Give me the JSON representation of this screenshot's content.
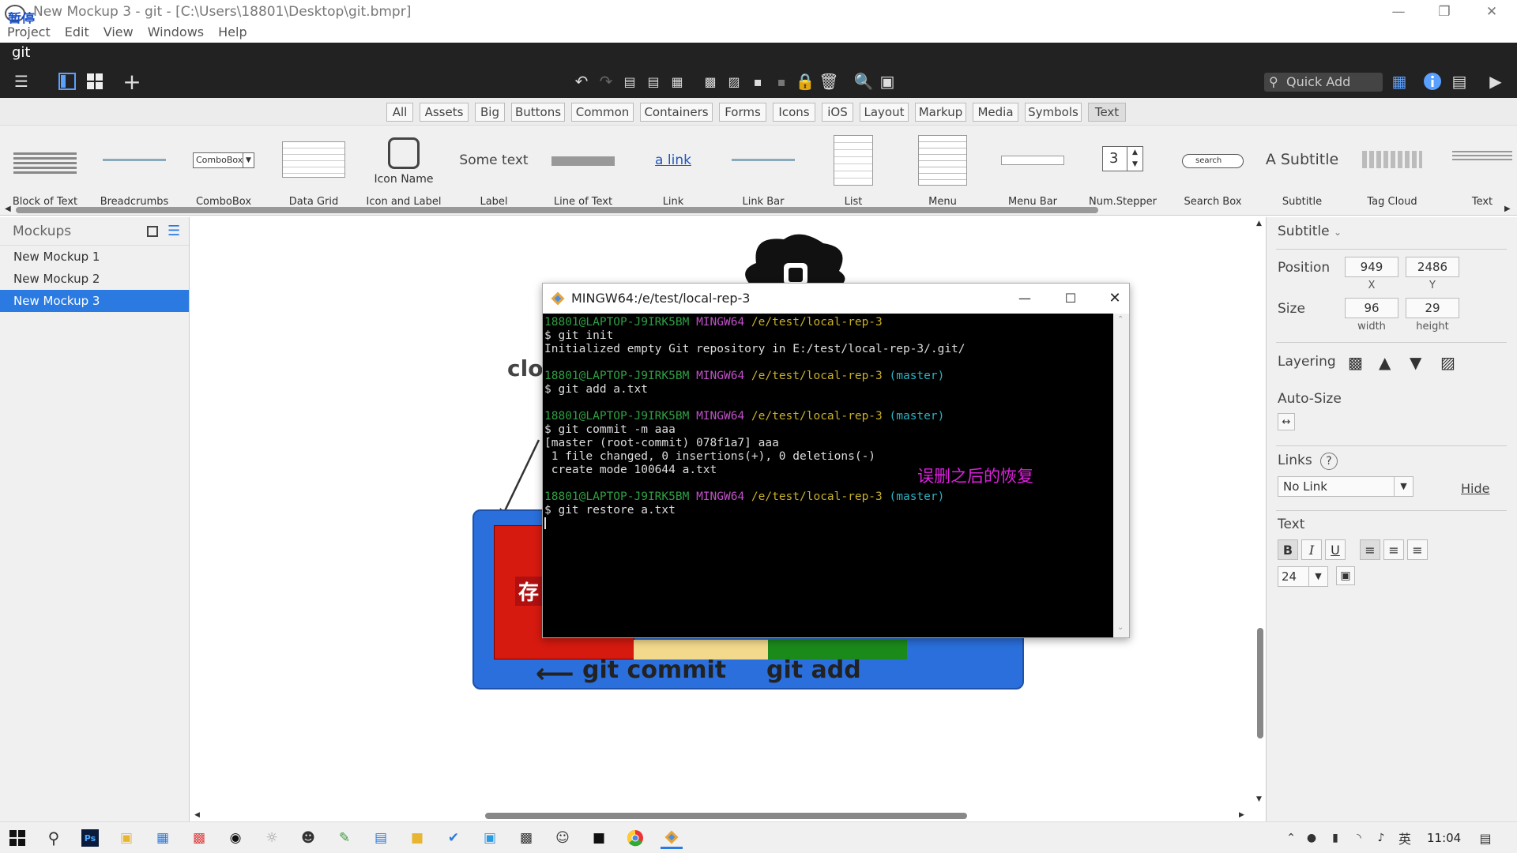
{
  "window": {
    "title": "New Mockup 3 - git - [C:\\Users\\18801\\Desktop\\git.bmpr]",
    "app_overlay_text": "暂停"
  },
  "menu": [
    "Project",
    "Edit",
    "View",
    "Windows",
    "Help"
  ],
  "document_tab": "git",
  "quick_add": {
    "placeholder": "Quick Add"
  },
  "filters": [
    "All",
    "Assets",
    "Big",
    "Buttons",
    "Common",
    "Containers",
    "Forms",
    "Icons",
    "iOS",
    "Layout",
    "Markup",
    "Media",
    "Symbols",
    "Text"
  ],
  "active_filter": "Text",
  "library": {
    "items": [
      "Block of Text",
      "Breadcrumbs",
      "ComboBox",
      "Data Grid",
      "Icon and Label",
      "Label",
      "Line of Text",
      "Link",
      "Link Bar",
      "List",
      "Menu",
      "Menu Bar",
      "Num.Stepper",
      "Search Box",
      "Subtitle",
      "Tag Cloud",
      "Text"
    ],
    "combobox_text": "ComboBox",
    "icon_name_text": "Icon Name",
    "label_text": "Some text",
    "link_text": "a link",
    "stepper_value": "3",
    "search_text": "search",
    "subtitle_text": "A Subtitle"
  },
  "mockups": {
    "header": "Mockups",
    "items": [
      "New Mockup 1",
      "New Mockup 2",
      "New Mockup 3"
    ],
    "selected": "New Mockup 3"
  },
  "canvas": {
    "partial_text": "clo",
    "box_text": "存",
    "git_commit": "git commit",
    "git_add": "git add",
    "colors": {
      "blue": "#2a6fdb",
      "red": "#d71a0f",
      "yellow": "#f3d98b",
      "green": "#1a8a1a"
    }
  },
  "terminal": {
    "title": "MINGW64:/e/test/local-rep-3",
    "user": "18801@LAPTOP-J9IRK5BM",
    "env": "MINGW64",
    "path": "/e/test/local-rep-3",
    "branch": "(master)",
    "cmd1": "$ git init",
    "out1": "Initialized empty Git repository in E:/test/local-rep-3/.git/",
    "cmd2": "$ git add a.txt",
    "cmd3": "$ git commit -m aaa",
    "out3a": "[master (root-commit) 078f1a7] aaa",
    "out3b": " 1 file changed, 0 insertions(+), 0 deletions(-)",
    "out3c": " create mode 100644 a.txt",
    "cmd4": "$ git restore a.txt",
    "annotation": "误删之后的恢复"
  },
  "inspector": {
    "component": "Subtitle",
    "position_label": "Position",
    "x": "949",
    "y": "2486",
    "x_label": "X",
    "y_label": "Y",
    "size_label": "Size",
    "width": "96",
    "height": "29",
    "width_label": "width",
    "height_label": "height",
    "layering_label": "Layering",
    "autosize_label": "Auto-Size",
    "links_label": "Links",
    "link_value": "No Link",
    "hide_label": "Hide",
    "text_label": "Text",
    "font_size": "24"
  },
  "taskbar": {
    "time": "11:04",
    "ime": "英"
  }
}
